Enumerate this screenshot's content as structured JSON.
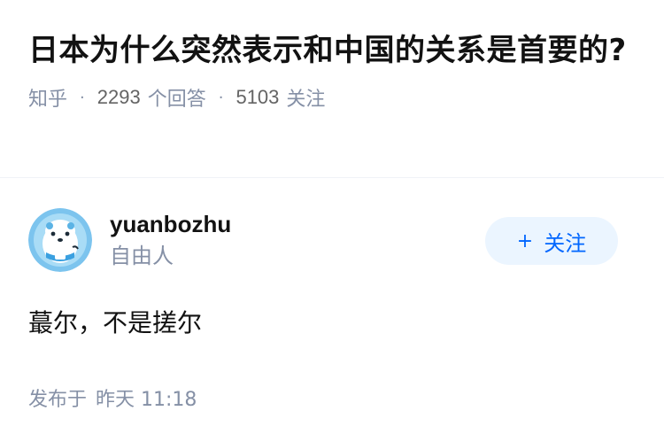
{
  "question": {
    "title": "日本为什么突然表示和中国的关系是首要的?",
    "source": "知乎",
    "separator": "·",
    "answer_count": "2293",
    "answer_label": "个回答",
    "follower_count": "5103",
    "follower_label": "关注"
  },
  "answer": {
    "author_name": "yuanbozhu",
    "author_bio": "自由人",
    "follow_button_plus": "+",
    "follow_button_label": "关注",
    "content": "蕞尔，不是搓尔",
    "published_prefix": "发布于",
    "published_time": "昨天 11:18",
    "avatar_icon": "mascot-avatar-icon"
  },
  "colors": {
    "accent": "#0066ff",
    "follow_bg": "#ebf5ff",
    "meta_text": "#8590a6",
    "primary_text": "#121212"
  }
}
